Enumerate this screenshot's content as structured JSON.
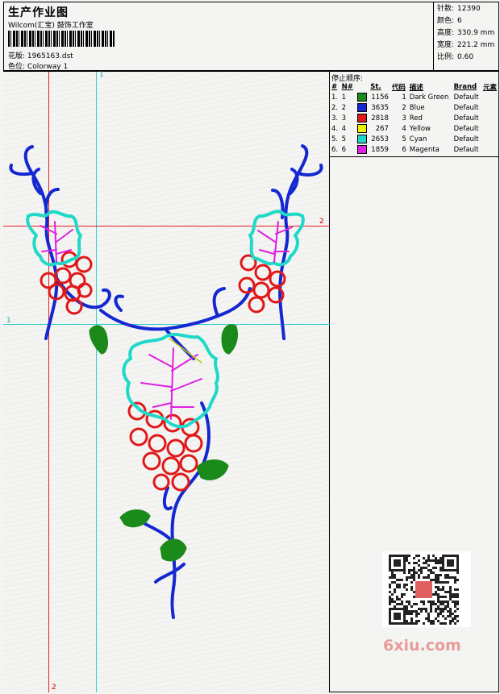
{
  "header": {
    "title": "生产作业图",
    "company": "Wilcom(汇宝) 鼓饰工作室",
    "design_label": "花版:",
    "design_value": "1965163.dst",
    "colorway_label": "色位:",
    "colorway_value": "Colorway 1"
  },
  "stats": {
    "stitches_label": "针数:",
    "stitches_value": "12390",
    "colors_label": "颜色:",
    "colors_value": "6",
    "height_label": "高度:",
    "height_value": "330.9 mm",
    "width_label": "宽度:",
    "width_value": "221.2 mm",
    "scale_label": "比例:",
    "scale_value": "0.60"
  },
  "stop_sequence": {
    "heading": "停止顺序:",
    "columns": [
      "#",
      "N#",
      "St.",
      "代码",
      "描述",
      "Brand",
      "元素"
    ],
    "rows": [
      {
        "num": "1.",
        "needle": "1",
        "color": "#1a8a1a",
        "stitches": "1156",
        "code": "1",
        "description": "Dark Green",
        "brand": "Default"
      },
      {
        "num": "2.",
        "needle": "2",
        "color": "#1428d2",
        "stitches": "3635",
        "code": "2",
        "description": "Blue",
        "brand": "Default"
      },
      {
        "num": "3.",
        "needle": "3",
        "color": "#e01818",
        "stitches": "2818",
        "code": "3",
        "description": "Red",
        "brand": "Default"
      },
      {
        "num": "4.",
        "needle": "4",
        "color": "#f0f000",
        "stitches": "267",
        "code": "4",
        "description": "Yellow",
        "brand": "Default"
      },
      {
        "num": "5.",
        "needle": "5",
        "color": "#20d8c8",
        "stitches": "2653",
        "code": "5",
        "description": "Cyan",
        "brand": "Default"
      },
      {
        "num": "6.",
        "needle": "6",
        "color": "#e020e0",
        "stitches": "1859",
        "code": "6",
        "description": "Magenta",
        "brand": "Default"
      }
    ]
  },
  "guides": {
    "top_marker": "1",
    "right_marker": "2",
    "left_marker": "1",
    "bottom_marker": "2"
  },
  "watermark": {
    "text": "6xiu.com",
    "qr_badge": "6秀 网站"
  },
  "colors": {
    "guide_red": "#e82020",
    "guide_cyan": "#30d0d0"
  }
}
